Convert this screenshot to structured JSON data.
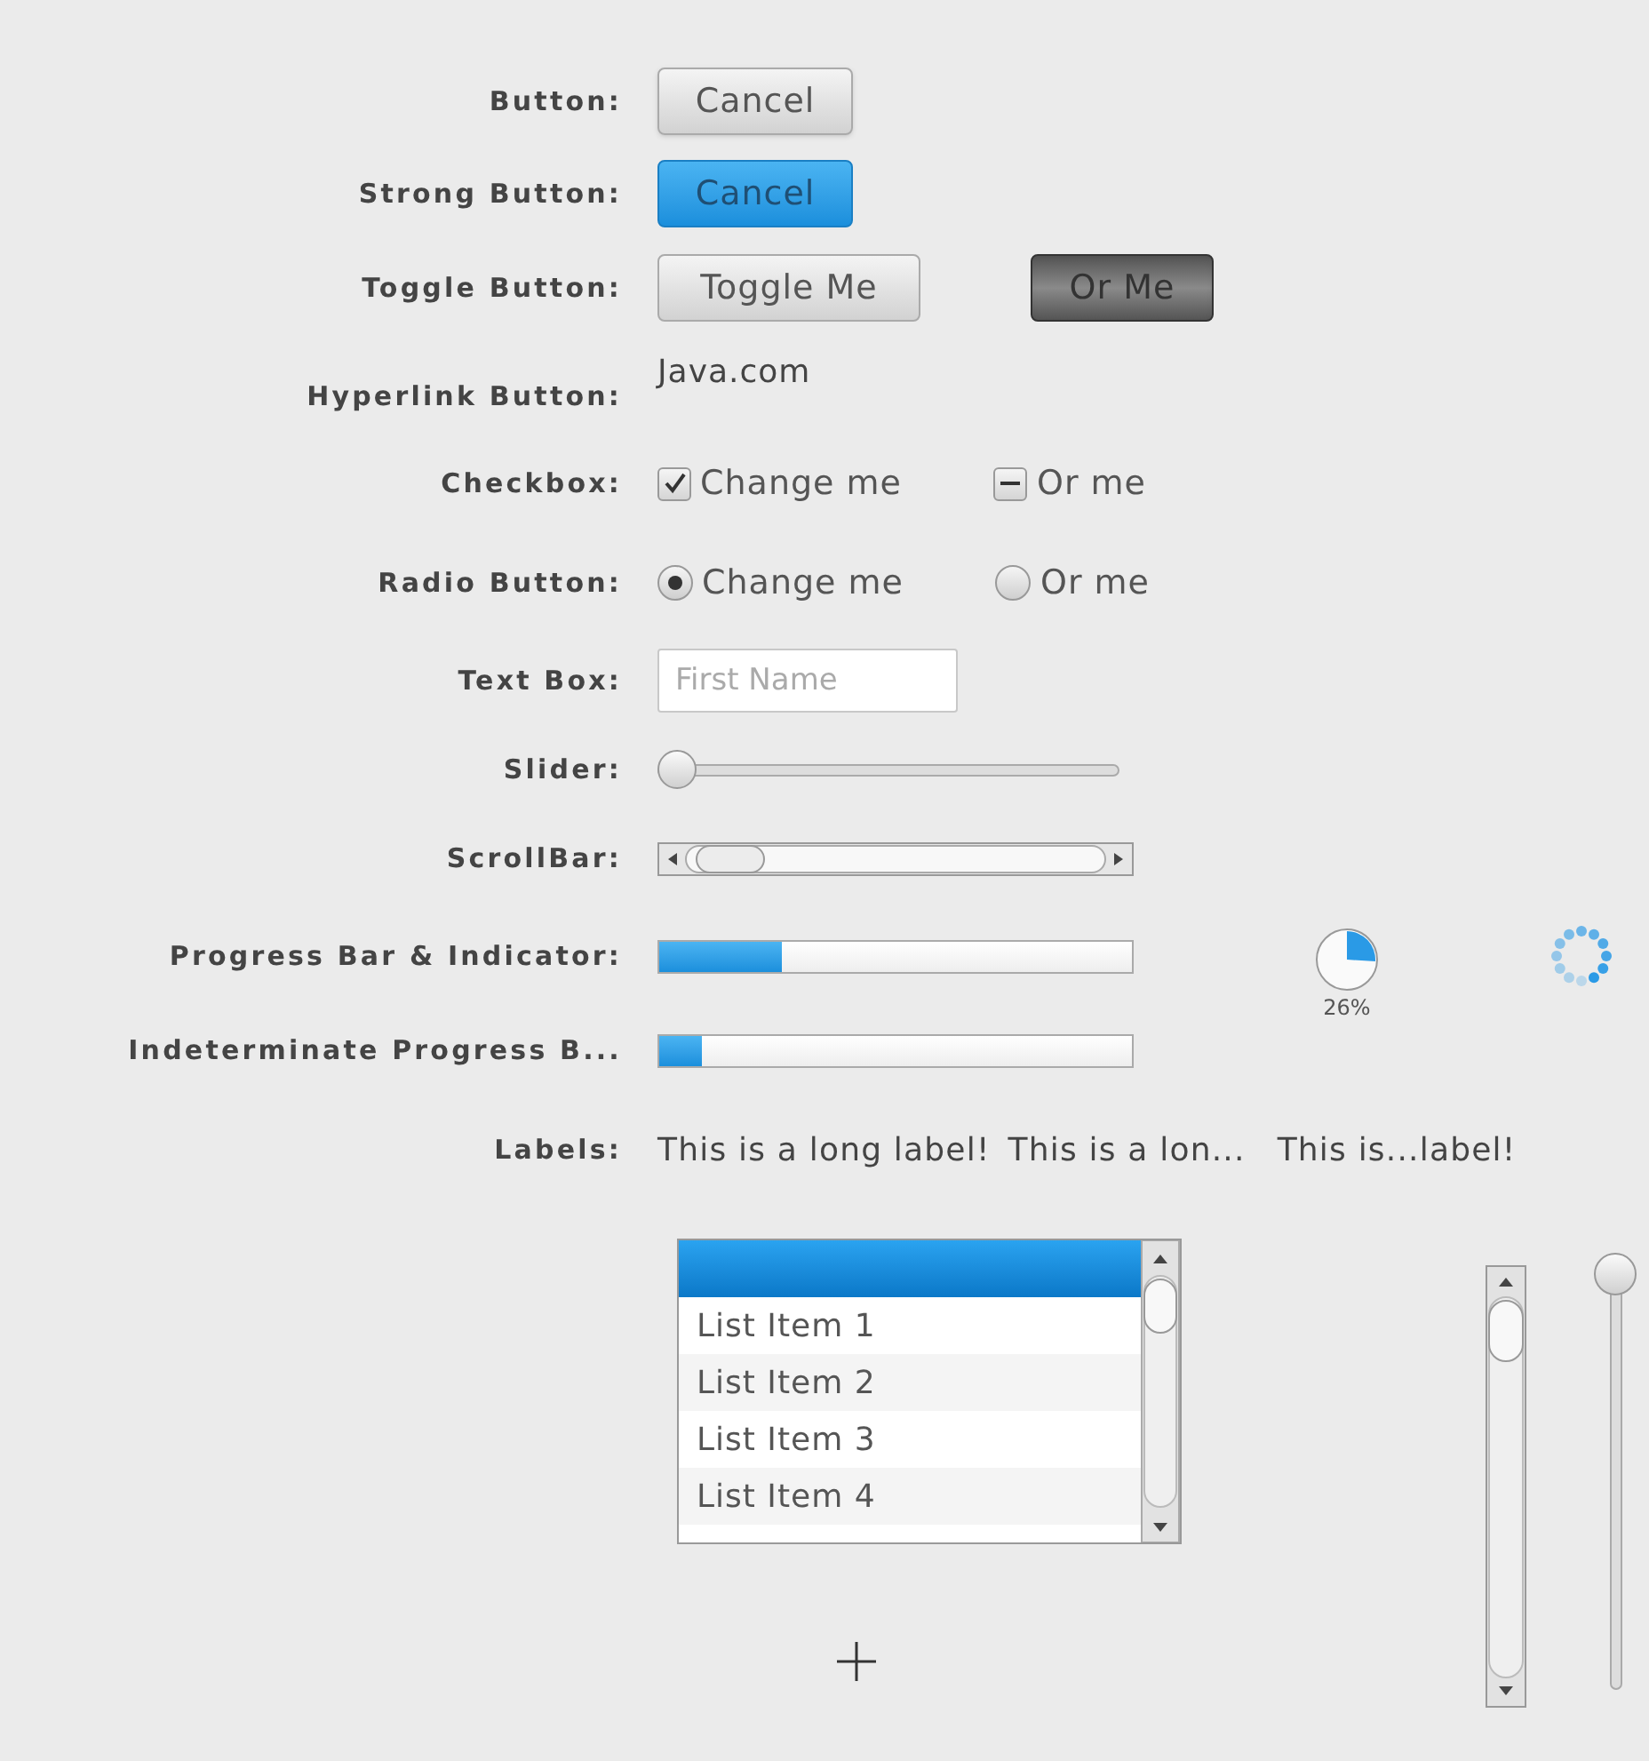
{
  "rows": [
    {
      "kind": "buttons",
      "label": "Button:",
      "buttons": [
        {
          "label": "Cancel",
          "kind": "plain"
        }
      ]
    },
    {
      "kind": "buttons",
      "label": "Strong Button:",
      "buttons": [
        {
          "label": "Cancel",
          "kind": "strong"
        }
      ]
    },
    {
      "kind": "toggles",
      "label": "Toggle Button:",
      "toggles": [
        {
          "label": "Toggle Me",
          "selected": false
        },
        {
          "label": "Or Me",
          "selected": true
        }
      ]
    },
    {
      "kind": "link",
      "label": "Hyperlink Button:",
      "link": "Java.com"
    },
    {
      "kind": "checkboxes",
      "label": "Checkbox:",
      "checkboxes": [
        {
          "label": "Change me",
          "checked": true,
          "indeterminate": false
        },
        {
          "label": "Or me",
          "checked": false,
          "indeterminate": true
        }
      ]
    },
    {
      "kind": "radios",
      "label": "Radio Button:",
      "radios": [
        {
          "label": "Change me",
          "selected": true
        },
        {
          "label": "Or me",
          "selected": false
        }
      ]
    },
    {
      "kind": "textbox",
      "label": "Text Box:",
      "placeholder": "First Name"
    },
    {
      "kind": "slider",
      "label": "Slider:",
      "level": 0
    },
    {
      "kind": "scrollbar",
      "label": "ScrollBar:"
    },
    {
      "kind": "progress",
      "label": "Progress Bar & Indicator:",
      "level": 0.26,
      "indicator": {
        "reading": "26%"
      }
    },
    {
      "kind": "indeterminate",
      "label": "Indeterminate Progress B...",
      "level": 0.09
    },
    {
      "kind": "labels",
      "label": "Labels:",
      "texts": [
        "This is a long label!",
        "This is a lon...",
        "This is...label!"
      ]
    }
  ],
  "list": {
    "items": [
      {
        "selected": true
      },
      {
        "label": "List Item 1",
        "selected": false
      },
      {
        "label": "List Item 2",
        "selected": false
      },
      {
        "label": "List Item 3",
        "selected": false
      },
      {
        "label": "List Item 4",
        "selected": false
      }
    ]
  },
  "vertical_slider": {
    "level": 1
  }
}
